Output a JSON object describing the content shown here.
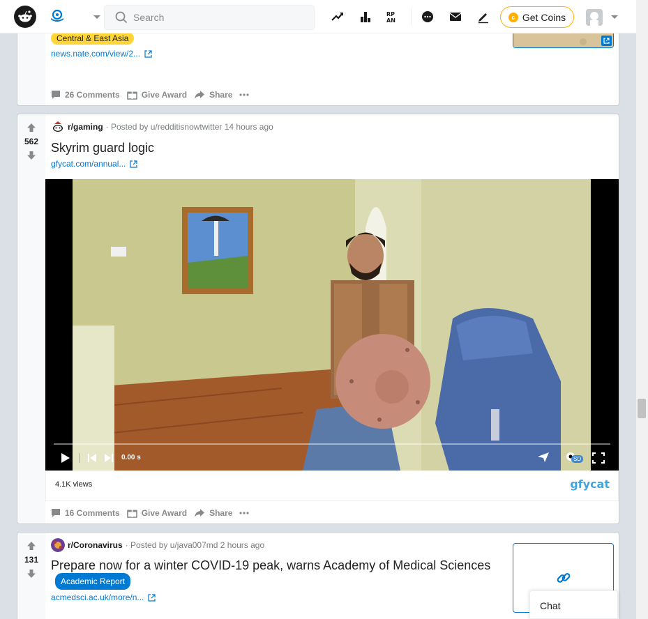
{
  "header": {
    "search_placeholder": "Search",
    "get_coins_label": "Get Coins",
    "icons": [
      "reddit-logo-icon",
      "home-icon",
      "chevron-down-icon",
      "search-icon",
      "trending-icon",
      "stats-icon",
      "rpan-icon",
      "chat-icon",
      "mail-icon",
      "create-post-icon",
      "coin-icon",
      "avatar-icon"
    ]
  },
  "posts": [
    {
      "flair": "Central & East Asia",
      "link_text": "news.nate.com/view/2...",
      "comments_label": "26 Comments",
      "award_label": "Give Award",
      "share_label": "Share"
    },
    {
      "votes": "562",
      "subreddit": "r/gaming",
      "posted_by": "· Posted by u/redditisnowtwitter 14 hours ago",
      "title": "Skyrim guard logic",
      "link_text": "gfycat.com/annual...",
      "video_time": "0.00 s",
      "video_quality": "SD",
      "views": "4.1K views",
      "provider": "gfycat",
      "comments_label": "16 Comments",
      "award_label": "Give Award",
      "share_label": "Share"
    },
    {
      "votes": "131",
      "subreddit": "r/Coronavirus",
      "posted_by": "· Posted by u/java007md 2 hours ago",
      "title": "Prepare now for a winter COVID-19 peak, warns Academy of Medical Sciences",
      "flair": "Academic Report",
      "link_text": "acmedsci.ac.uk/more/n..."
    }
  ],
  "chat": {
    "label": "Chat"
  },
  "colors": {
    "accent": "#0079d3",
    "upvote": "#878a8c",
    "coin": "#ffb000",
    "flair_yellow": "#ffd635"
  }
}
